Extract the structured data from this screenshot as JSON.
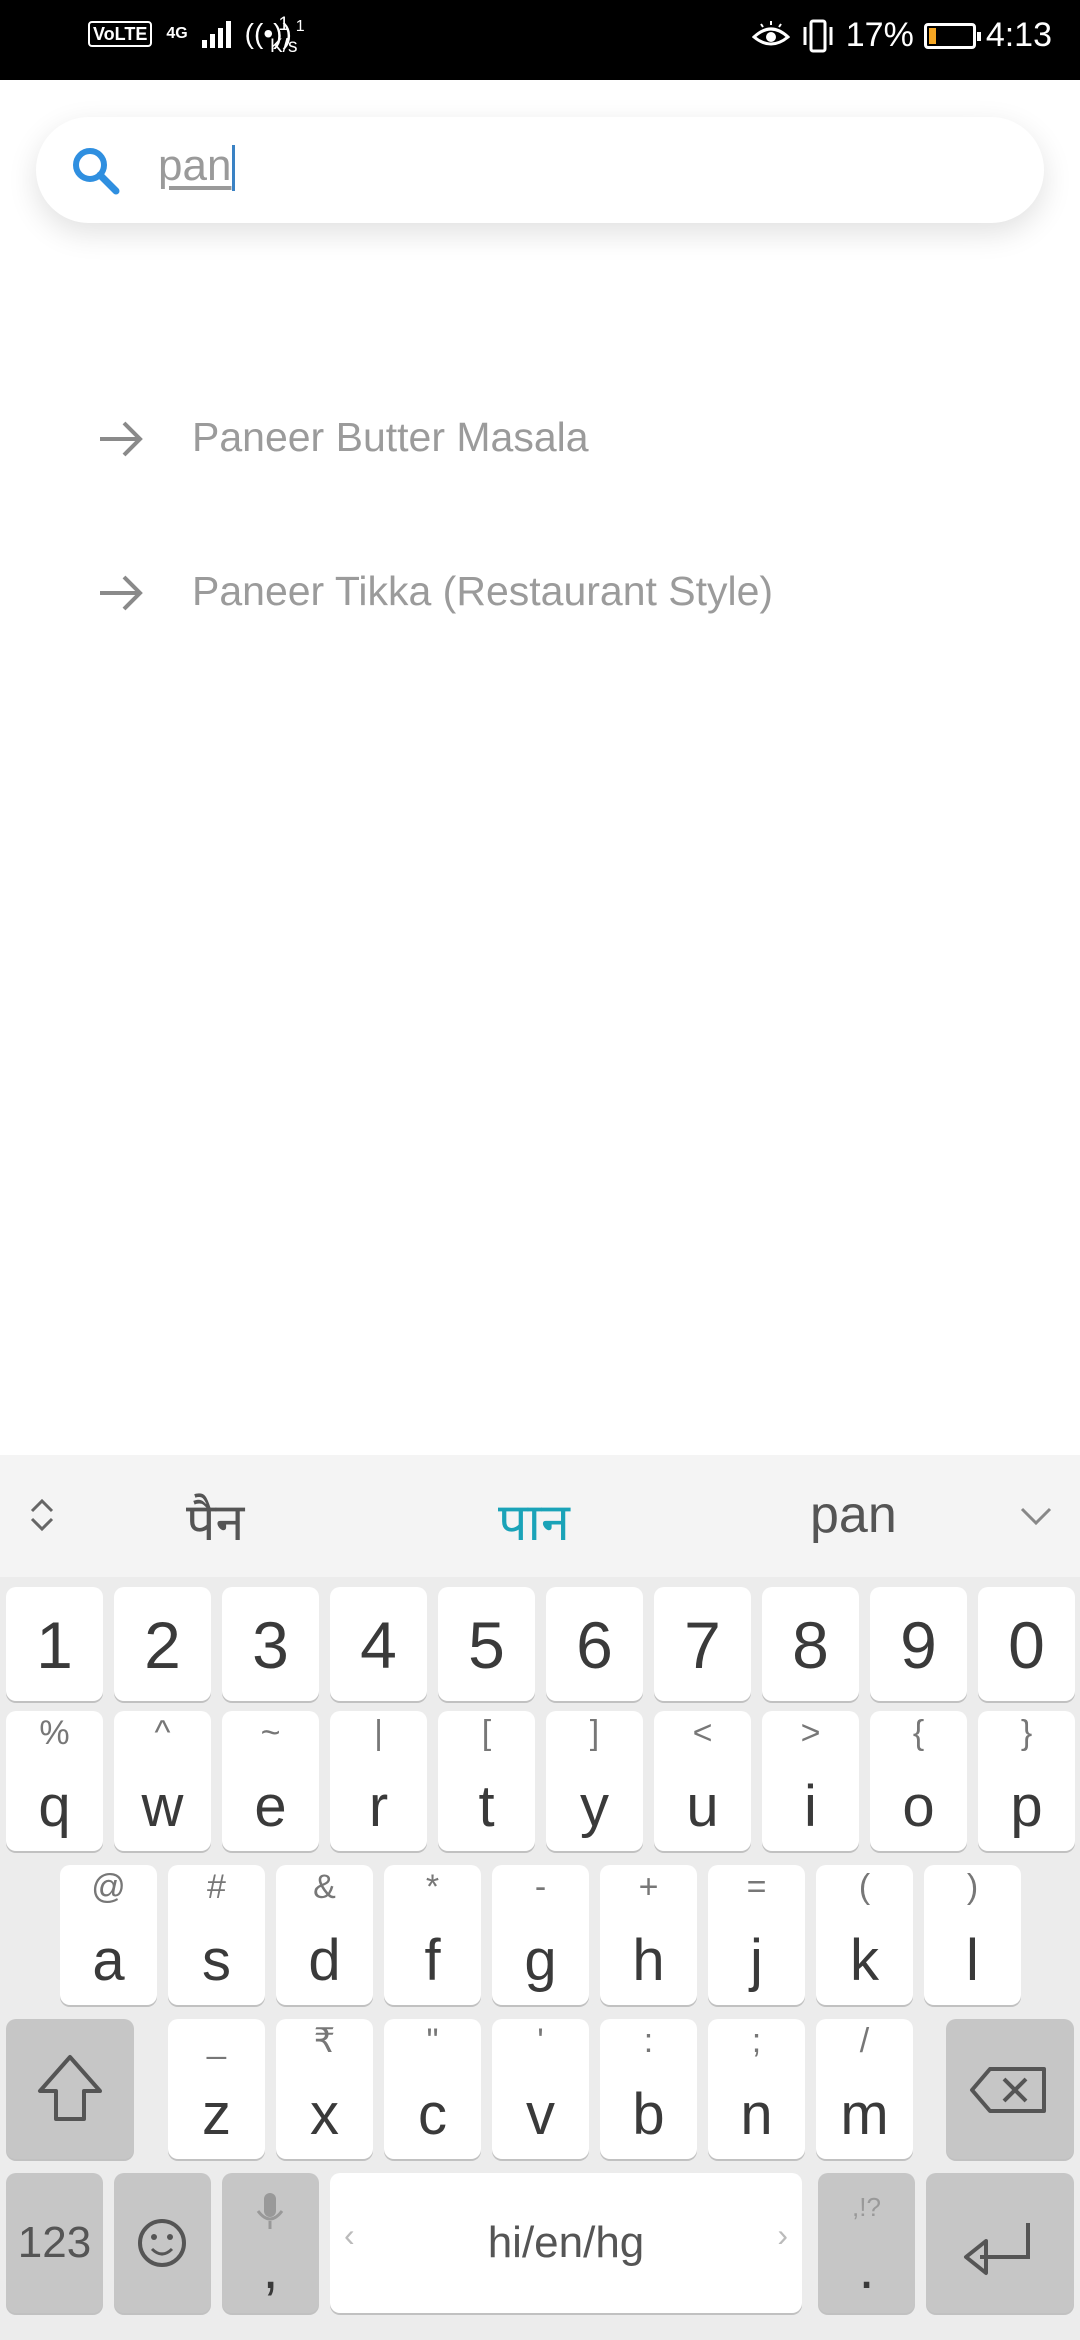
{
  "status_bar": {
    "volte": "VoLTE",
    "network": "4G",
    "speed_value": "1",
    "speed_unit": "K/s",
    "hotspot_count": "1",
    "battery_percent": "17%",
    "battery_level": 0.17,
    "time": "4:13",
    "icons": [
      "eye-comfort-icon",
      "vibrate-icon",
      "battery-icon"
    ]
  },
  "search": {
    "query": "pan",
    "icon": "search-icon"
  },
  "suggestions": [
    {
      "label": "Paneer Butter Masala",
      "icon": "arrow-right-icon"
    },
    {
      "label": "Paneer Tikka (Restaurant Style)",
      "icon": "arrow-right-icon"
    }
  ],
  "keyboard": {
    "candidates": [
      "पैन",
      "पान",
      "pan"
    ],
    "active_candidate_index": 1,
    "numbers": [
      "1",
      "2",
      "3",
      "4",
      "5",
      "6",
      "7",
      "8",
      "9",
      "0"
    ],
    "row1": [
      {
        "main": "q",
        "alt": "%"
      },
      {
        "main": "w",
        "alt": "^"
      },
      {
        "main": "e",
        "alt": "~"
      },
      {
        "main": "r",
        "alt": "|"
      },
      {
        "main": "t",
        "alt": "["
      },
      {
        "main": "y",
        "alt": "]"
      },
      {
        "main": "u",
        "alt": "<"
      },
      {
        "main": "i",
        "alt": ">"
      },
      {
        "main": "o",
        "alt": "{"
      },
      {
        "main": "p",
        "alt": "}"
      }
    ],
    "row2": [
      {
        "main": "a",
        "alt": "@"
      },
      {
        "main": "s",
        "alt": "#"
      },
      {
        "main": "d",
        "alt": "&"
      },
      {
        "main": "f",
        "alt": "*"
      },
      {
        "main": "g",
        "alt": "-"
      },
      {
        "main": "h",
        "alt": "+"
      },
      {
        "main": "j",
        "alt": "="
      },
      {
        "main": "k",
        "alt": "("
      },
      {
        "main": "l",
        "alt": ")"
      }
    ],
    "row3": [
      {
        "main": "z",
        "alt": "_"
      },
      {
        "main": "x",
        "alt": "₹"
      },
      {
        "main": "c",
        "alt": "\""
      },
      {
        "main": "v",
        "alt": "'"
      },
      {
        "main": "b",
        "alt": ":"
      },
      {
        "main": "n",
        "alt": ";"
      },
      {
        "main": "m",
        "alt": "/"
      }
    ],
    "mode_key": "123",
    "comma": ",",
    "space_label": "hi/en/hg",
    "period": ".",
    "period_alt": ",!?",
    "colors": {
      "accent": "#1aa3b8",
      "key_bg": "#ffffff",
      "dark_key_bg": "#c6c6c6",
      "board_bg": "#ececec"
    }
  }
}
